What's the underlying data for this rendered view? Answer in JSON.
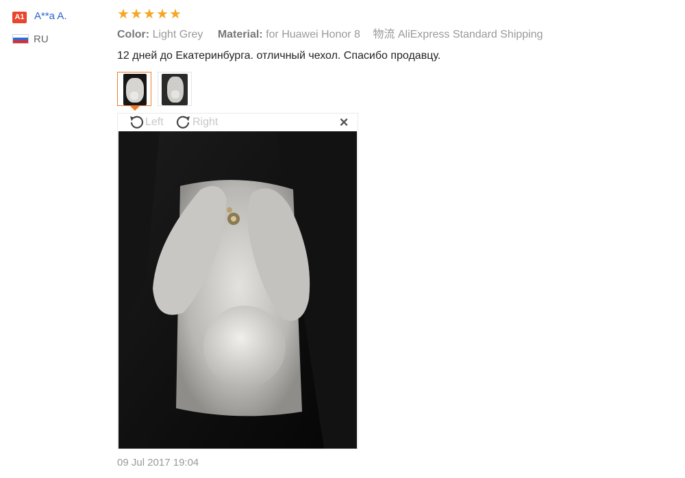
{
  "reviewer": {
    "badge": "A1",
    "name": "A**a A.",
    "country": "RU",
    "flag_icon": "russia-flag-icon"
  },
  "rating": {
    "stars": 5,
    "max": 5,
    "color": "#f5a623"
  },
  "attributes": {
    "color_label": "Color:",
    "color_value": "Light Grey",
    "material_label": "Material:",
    "material_value": "for Huawei Honor 8",
    "shipping_label": "物流",
    "shipping_value": "AliExpress Standard Shipping"
  },
  "feedback_text": "12 дней до Екатеринбурга. отличный чехол. Спасибо продавцу.",
  "thumbnails": {
    "count": 2,
    "selected_index": 0,
    "selected_border": "#f07a24"
  },
  "viewer": {
    "rotate_left_label": "Left",
    "rotate_right_label": "Right",
    "close_icon": "close-icon"
  },
  "timestamp": "09 Jul 2017 19:04"
}
